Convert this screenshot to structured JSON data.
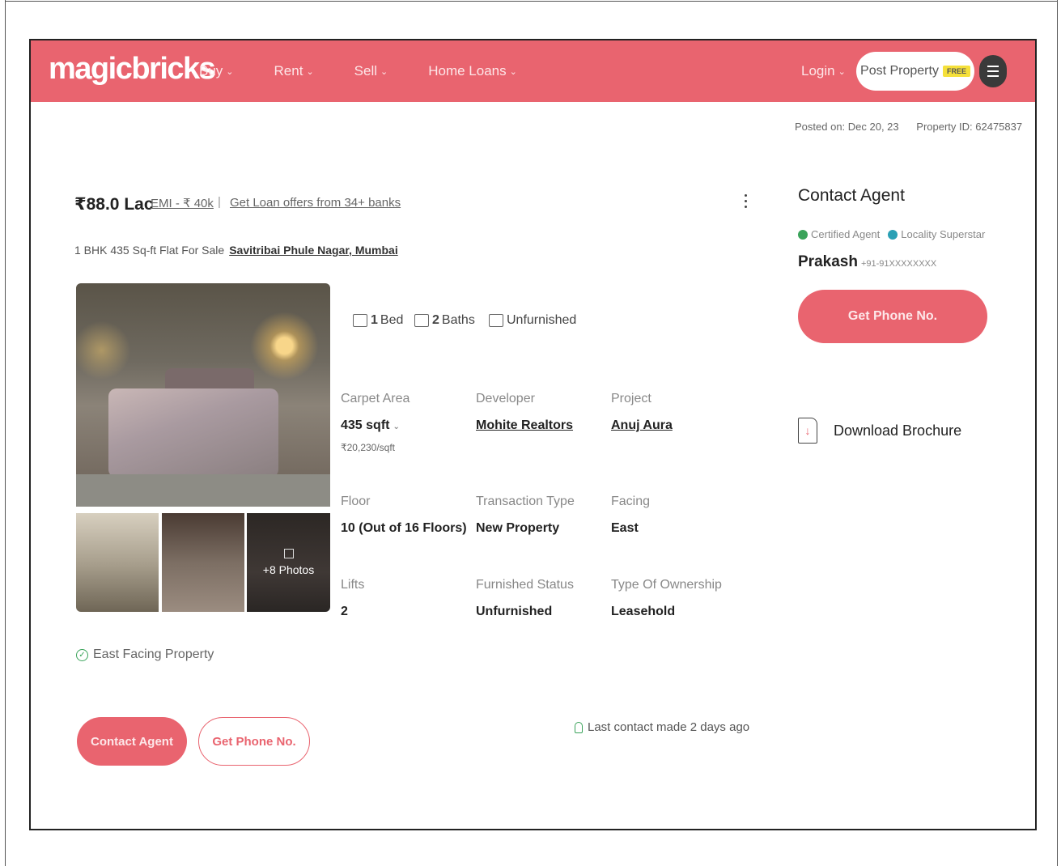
{
  "header": {
    "logo": "magicbricks",
    "nav": [
      {
        "label": "Buy",
        "chevron": "⌄"
      },
      {
        "label": "Rent",
        "chevron": "⌄"
      },
      {
        "label": "Sell",
        "chevron": "⌄"
      },
      {
        "label": "Home Loans",
        "chevron": "⌄"
      }
    ],
    "login": "Login",
    "post_property": "Post Property",
    "free_badge": "FREE",
    "brand_color": "#e9646f"
  },
  "meta": {
    "posted_on": "Posted on: Dec 20, 23",
    "property_id": "Property ID: 62475837"
  },
  "listing": {
    "price": "₹88.0 Lac",
    "emi": "EMI - ₹ 40k",
    "separator": "|",
    "loan_link": "Get Loan offers from 34+ banks",
    "subtitle": "1 BHK 435 Sq-ft Flat For Sale",
    "locality": "Savitribai Phule Nagar, Mumbai",
    "more_photos": "+8 Photos",
    "east_facing": "East Facing Property",
    "amenities": {
      "bed_count": "1",
      "bed_label": "Bed",
      "bath_count": "2",
      "bath_label": "Baths",
      "furnishing": "Unfurnished"
    },
    "details": {
      "carpet_area_label": "Carpet Area",
      "carpet_area_value": "435 sqft",
      "carpet_area_sub": "₹20,230/sqft",
      "developer_label": "Developer",
      "developer_value": "Mohite Realtors",
      "project_label": "Project",
      "project_value": "Anuj Aura",
      "floor_label": "Floor",
      "floor_value": "10 (Out of 16 Floors)",
      "transaction_label": "Transaction Type",
      "transaction_value": "New Property",
      "facing_label": "Facing",
      "facing_value": "East",
      "lifts_label": "Lifts",
      "lifts_value": "2",
      "furnished_label": "Furnished Status",
      "furnished_value": "Unfurnished",
      "ownership_label": "Type Of Ownership",
      "ownership_value": "Leasehold"
    },
    "contact_agent_btn": "Contact Agent",
    "get_phone_btn": "Get Phone No.",
    "last_contact": "Last contact made 2 days ago"
  },
  "agent": {
    "title": "Contact Agent",
    "certified": "Certified Agent",
    "superstar": "Locality Superstar",
    "name": "Prakash",
    "phone": "+91-91XXXXXXXX",
    "get_phone_btn": "Get Phone No.",
    "brochure": "Download Brochure"
  }
}
